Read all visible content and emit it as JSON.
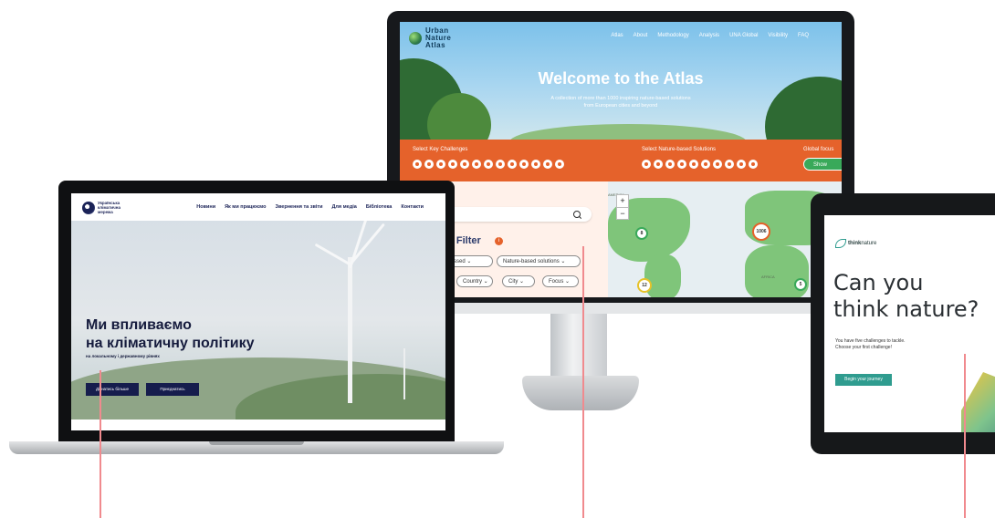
{
  "atlas": {
    "logo": [
      "Urban",
      "Nature",
      "Atlas"
    ],
    "nav": [
      "Atlas",
      "About",
      "Methodology",
      "Analysis",
      "UNA Global",
      "Visibility",
      "FAQ"
    ],
    "title": "Welcome to the Atlas",
    "subtitle_line1": "A collection of more than 1000 inspiring nature-based solutions",
    "subtitle_line2": "from European cities and beyond",
    "challenges_label": "Select Key Challenges",
    "solutions_label": "Select Nature-based Solutions",
    "global_label": "Global focus",
    "show_button": "Show",
    "filter_title": "ed Filter",
    "filter_info": "i",
    "pills": [
      "ddressed",
      "Nature-based solutions",
      "Country",
      "City",
      "Focus"
    ],
    "zoom_in": "+",
    "zoom_out": "−",
    "map_labels": [
      "AMERICA",
      "AFRICA"
    ],
    "markers": [
      "8",
      "1006",
      "12",
      "5"
    ]
  },
  "laptop": {
    "logo_lines": [
      "Українська",
      "кліматична",
      "мережа"
    ],
    "nav": [
      "Новини",
      "Як ми працюємо",
      "Звернення та звіти",
      "Для медіа",
      "Бібліотека",
      "Контакти"
    ],
    "headline_line1": "Ми впливаємо",
    "headline_line2": "на кліматичну політику",
    "subheadline": "на локальному і державному рівнях",
    "btn_learn": "Дізнатись більше",
    "btn_join": "Приєднатись"
  },
  "tablet": {
    "brand": "thinknature",
    "brand_bold": "think",
    "brand_rest": "nature",
    "headline_line1": "Can you",
    "headline_line2": "think nature?",
    "body": "You have five challenges to tackle. Choose your first challenge!",
    "cta": "Begin your journey"
  },
  "colors": {
    "atlas_orange": "#e5622b",
    "atlas_green": "#39a95a",
    "laptop_navy": "#161d4d",
    "thinknature_teal": "#2f9c8f",
    "callout_pink": "#f08a8e"
  }
}
